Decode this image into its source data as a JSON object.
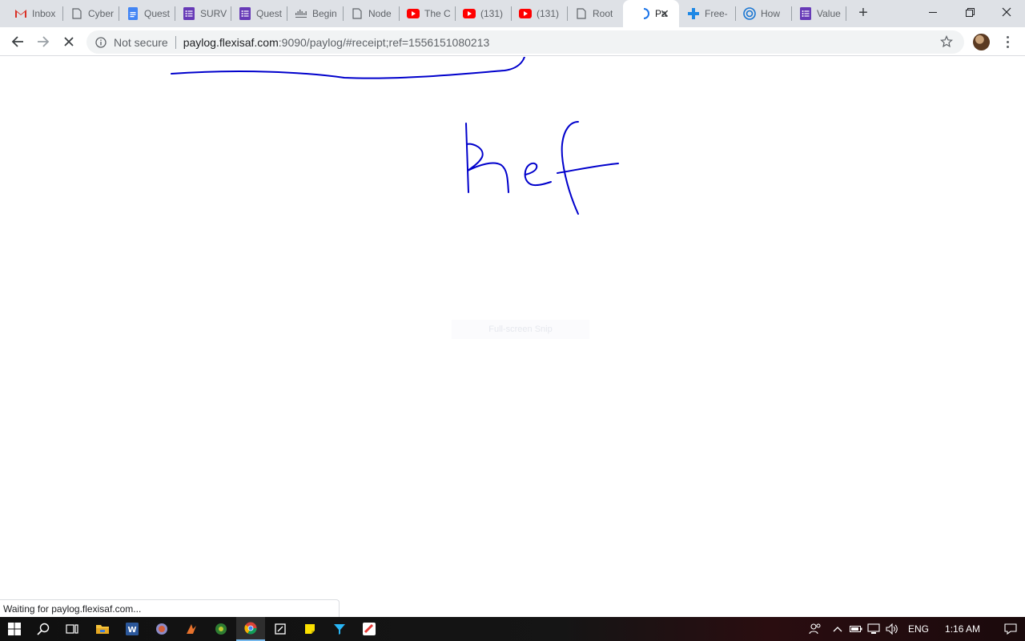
{
  "browser": {
    "tabs": [
      {
        "title": "Inbox",
        "icon": "gmail-icon",
        "color": "#d93025"
      },
      {
        "title": "Cyber",
        "icon": "document-icon",
        "color": "#5f6368"
      },
      {
        "title": "Quest",
        "icon": "google-docs-icon",
        "color": "#4285f4"
      },
      {
        "title": "SURV",
        "icon": "google-forms-icon",
        "color": "#673ab7"
      },
      {
        "title": "Quest",
        "icon": "google-forms-icon",
        "color": "#673ab7"
      },
      {
        "title": "Begin",
        "icon": "cisco-icon",
        "color": "#5f6368"
      },
      {
        "title": "Node",
        "icon": "document-icon",
        "color": "#5f6368"
      },
      {
        "title": "The C",
        "icon": "youtube-icon",
        "color": "#ff0000"
      },
      {
        "title": "(131)",
        "icon": "youtube-icon",
        "color": "#ff0000"
      },
      {
        "title": "(131)",
        "icon": "youtube-icon",
        "color": "#ff0000"
      },
      {
        "title": "Root",
        "icon": "document-icon",
        "color": "#5f6368"
      },
      {
        "title": "Pa",
        "icon": "loading-spinner-icon",
        "color": "#1a73e8",
        "active": true
      },
      {
        "title": "Free-",
        "icon": "plus-cross-icon",
        "color": "#1e88e5"
      },
      {
        "title": "How",
        "icon": "circle-logo-icon",
        "color": "#1976d2"
      },
      {
        "title": "Value",
        "icon": "google-forms-icon",
        "color": "#673ab7"
      }
    ],
    "new_tab": "+",
    "address": {
      "security_label": "Not secure",
      "url_host": "paylog.flexisaf.com",
      "url_rest": ":9090/paylog/#receipt;ref=1556151080213"
    }
  },
  "page": {
    "handwriting": "Ref",
    "ink_color": "#0000cc",
    "snip_hint": "Full-screen Snip",
    "status_text": "Waiting for paylog.flexisaf.com..."
  },
  "taskbar": {
    "apps": [
      "windows-start-icon",
      "search-icon",
      "task-view-icon",
      "file-explorer-icon",
      "word-icon",
      "app-icon",
      "app-icon",
      "app-icon",
      "chrome-icon",
      "app-icon",
      "sticky-notes-icon",
      "app-icon",
      "app-icon"
    ],
    "language": "ENG",
    "time": "1:16 AM"
  }
}
